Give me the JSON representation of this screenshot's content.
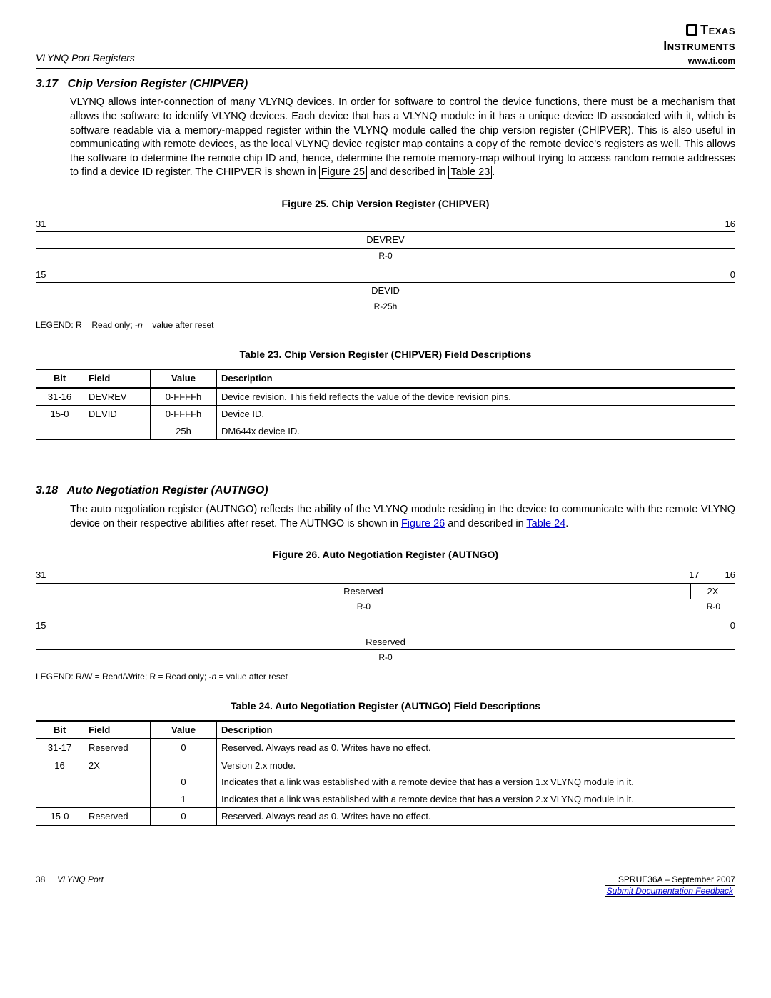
{
  "header": {
    "section_label": "VLYNQ Port Registers",
    "brand_top": "Texas",
    "brand_bot": "Instruments",
    "url": "www.ti.com"
  },
  "section_317": {
    "num": "3.17",
    "title": "Chip Version Register (CHIPVER)",
    "paragraph": "VLYNQ allows inter-connection of many VLYNQ devices. In order for software to control the device functions, there must be a mechanism that allows the software to identify VLYNQ devices. Each device that has a VLYNQ module in it has a unique device ID associated with it, which is software readable via a memory-mapped register within the VLYNQ module called the chip version register (CHIPVER). This is also useful in communicating with remote devices, as the local VLYNQ device register map contains a copy of the remote device's registers as well. This allows the software to determine the remote chip ID and, hence, determine the remote memory-map without trying to access random remote addresses to find a device ID register. The CHIPVER is shown in ",
    "link_fig": "Figure 25",
    "mid_text": " and described in ",
    "link_tbl": "Table 23",
    "period": "."
  },
  "figure25": {
    "caption": "Figure 25. Chip Version Register (CHIPVER)",
    "bit_hi_left": "31",
    "bit_hi_right": "16",
    "field1": "DEVREV",
    "rw1": "R-0",
    "bit_lo_left": "15",
    "bit_lo_right": "0",
    "field2": "DEVID",
    "rw2": "R-25h",
    "legend": "LEGEND: R = Read only; -n = value after reset"
  },
  "table23": {
    "caption": "Table 23. Chip Version Register (CHIPVER) Field Descriptions",
    "headers": {
      "bit": "Bit",
      "field": "Field",
      "value": "Value",
      "desc": "Description"
    },
    "rows": [
      {
        "bit": "31-16",
        "field": "DEVREV",
        "value": "0-FFFFh",
        "desc": "Device revision. This field reflects the value of the device revision pins."
      },
      {
        "bit": "15-0",
        "field": "DEVID",
        "value": "0-FFFFh",
        "desc": "Device ID."
      },
      {
        "bit": "",
        "field": "",
        "value": "25h",
        "desc": "DM644x device ID."
      }
    ]
  },
  "section_318": {
    "num": "3.18",
    "title": "Auto Negotiation Register (AUTNGO)",
    "paragraph": "The auto negotiation register (AUTNGO) reflects the ability of the VLYNQ module residing in the device to communicate with the remote VLYNQ device on their respective abilities after reset. The AUTNGO is shown in ",
    "link_fig": "Figure 26",
    "mid_text": " and described in ",
    "link_tbl": "Table 24",
    "period": "."
  },
  "figure26": {
    "caption": "Figure 26. Auto Negotiation Register (AUTNGO)",
    "bit_hi_left": "31",
    "bit_hi_mid": "17",
    "bit_hi_right": "16",
    "field1a": "Reserved",
    "field1b": "2X",
    "rw1a": "R-0",
    "rw1b": "R-0",
    "bit_lo_left": "15",
    "bit_lo_right": "0",
    "field2": "Reserved",
    "rw2": "R-0",
    "legend": "LEGEND: R/W = Read/Write; R = Read only; -n = value after reset"
  },
  "table24": {
    "caption": "Table 24. Auto Negotiation Register (AUTNGO) Field Descriptions",
    "headers": {
      "bit": "Bit",
      "field": "Field",
      "value": "Value",
      "desc": "Description"
    },
    "rows": [
      {
        "bit": "31-17",
        "field": "Reserved",
        "value": "0",
        "desc": "Reserved. Always read as 0. Writes have no effect."
      },
      {
        "bit": "16",
        "field": "2X",
        "value": "",
        "desc": "Version 2.x mode."
      },
      {
        "bit": "",
        "field": "",
        "value": "0",
        "desc": "Indicates that a link was established with a remote device that has a version 1.x VLYNQ module in it."
      },
      {
        "bit": "",
        "field": "",
        "value": "1",
        "desc": "Indicates that a link was established with a remote device that has a version 2.x VLYNQ module in it."
      },
      {
        "bit": "15-0",
        "field": "Reserved",
        "value": "0",
        "desc": "Reserved. Always read as 0. Writes have no effect."
      }
    ]
  },
  "footer": {
    "page": "38",
    "title": "VLYNQ Port",
    "docnum": "SPRUE36A – September 2007",
    "feedback": "Submit Documentation Feedback"
  }
}
